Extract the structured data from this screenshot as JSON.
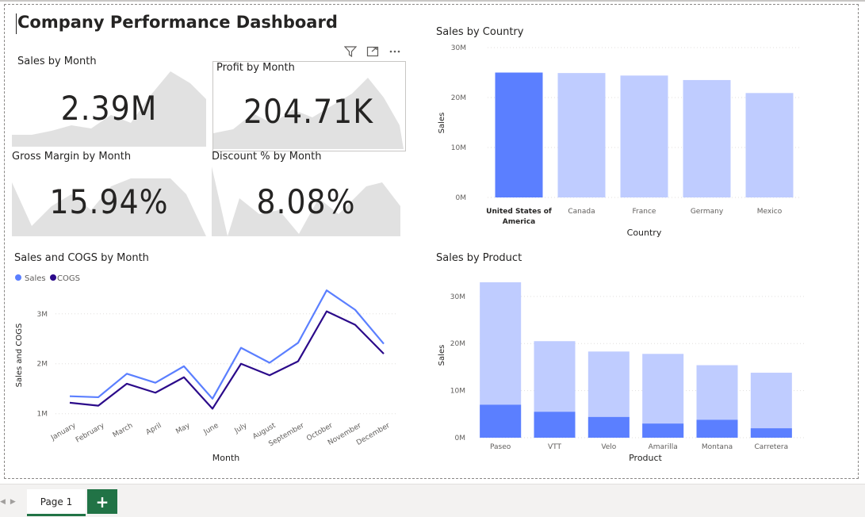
{
  "report": {
    "title": "Company Performance Dashboard"
  },
  "kpis": {
    "sales": {
      "title": "Sales by Month",
      "value": "2.39M"
    },
    "profit": {
      "title": "Profit by Month",
      "value": "204.71K"
    },
    "gross_margin": {
      "title": "Gross Margin by Month",
      "value": "15.94%"
    },
    "discount": {
      "title": "Discount % by Month",
      "value": "8.08%"
    }
  },
  "visual_header": {
    "filter_icon": "filter-icon",
    "focus_icon": "focus-mode-icon",
    "more_icon": "more-options-icon"
  },
  "colors": {
    "accent": "#5B7FFF",
    "light": "#BFCCFF",
    "cogs": "#2B0A8A",
    "sparkline": "#E1E1E1"
  },
  "chart_data": [
    {
      "type": "bar",
      "title": "Sales by Country",
      "xlabel": "Country",
      "ylabel": "Sales",
      "categories": [
        "United States of America",
        "Canada",
        "France",
        "Germany",
        "Mexico"
      ],
      "values": [
        25.0,
        24.9,
        24.4,
        23.5,
        20.9
      ],
      "highlighted": "United States of America",
      "ylim": [
        0,
        30
      ],
      "yticks": [
        "0M",
        "10M",
        "20M",
        "30M"
      ]
    },
    {
      "type": "line",
      "title": "Sales and COGS by Month",
      "xlabel": "Month",
      "ylabel": "Sales and COGS",
      "legend_position": "top-left",
      "categories": [
        "January",
        "February",
        "March",
        "April",
        "May",
        "June",
        "July",
        "August",
        "September",
        "October",
        "November",
        "December"
      ],
      "series": [
        {
          "name": "Sales",
          "values": [
            1.35,
            1.33,
            1.8,
            1.62,
            1.95,
            1.3,
            2.32,
            2.02,
            2.42,
            3.47,
            3.08,
            2.4
          ]
        },
        {
          "name": "COGS",
          "values": [
            1.22,
            1.16,
            1.6,
            1.42,
            1.73,
            1.1,
            2.0,
            1.77,
            2.05,
            3.05,
            2.78,
            2.2
          ]
        }
      ],
      "ylim": [
        0.9,
        3.6
      ],
      "yticks": [
        "1M",
        "2M",
        "3M"
      ]
    },
    {
      "type": "bar",
      "title": "Sales by Product",
      "xlabel": "Product",
      "ylabel": "Sales",
      "categories": [
        "Paseo",
        "VTT",
        "Velo",
        "Amarilla",
        "Montana",
        "Carretera"
      ],
      "values": [
        33.0,
        20.5,
        18.3,
        17.8,
        15.4,
        13.8
      ],
      "highlighted_values": [
        7.0,
        5.5,
        4.4,
        3.0,
        3.8,
        2.0
      ],
      "ylim": [
        0,
        33
      ],
      "yticks": [
        "0M",
        "10M",
        "20M",
        "30M"
      ]
    }
  ],
  "tabs": {
    "page1": "Page 1",
    "add": "+"
  }
}
